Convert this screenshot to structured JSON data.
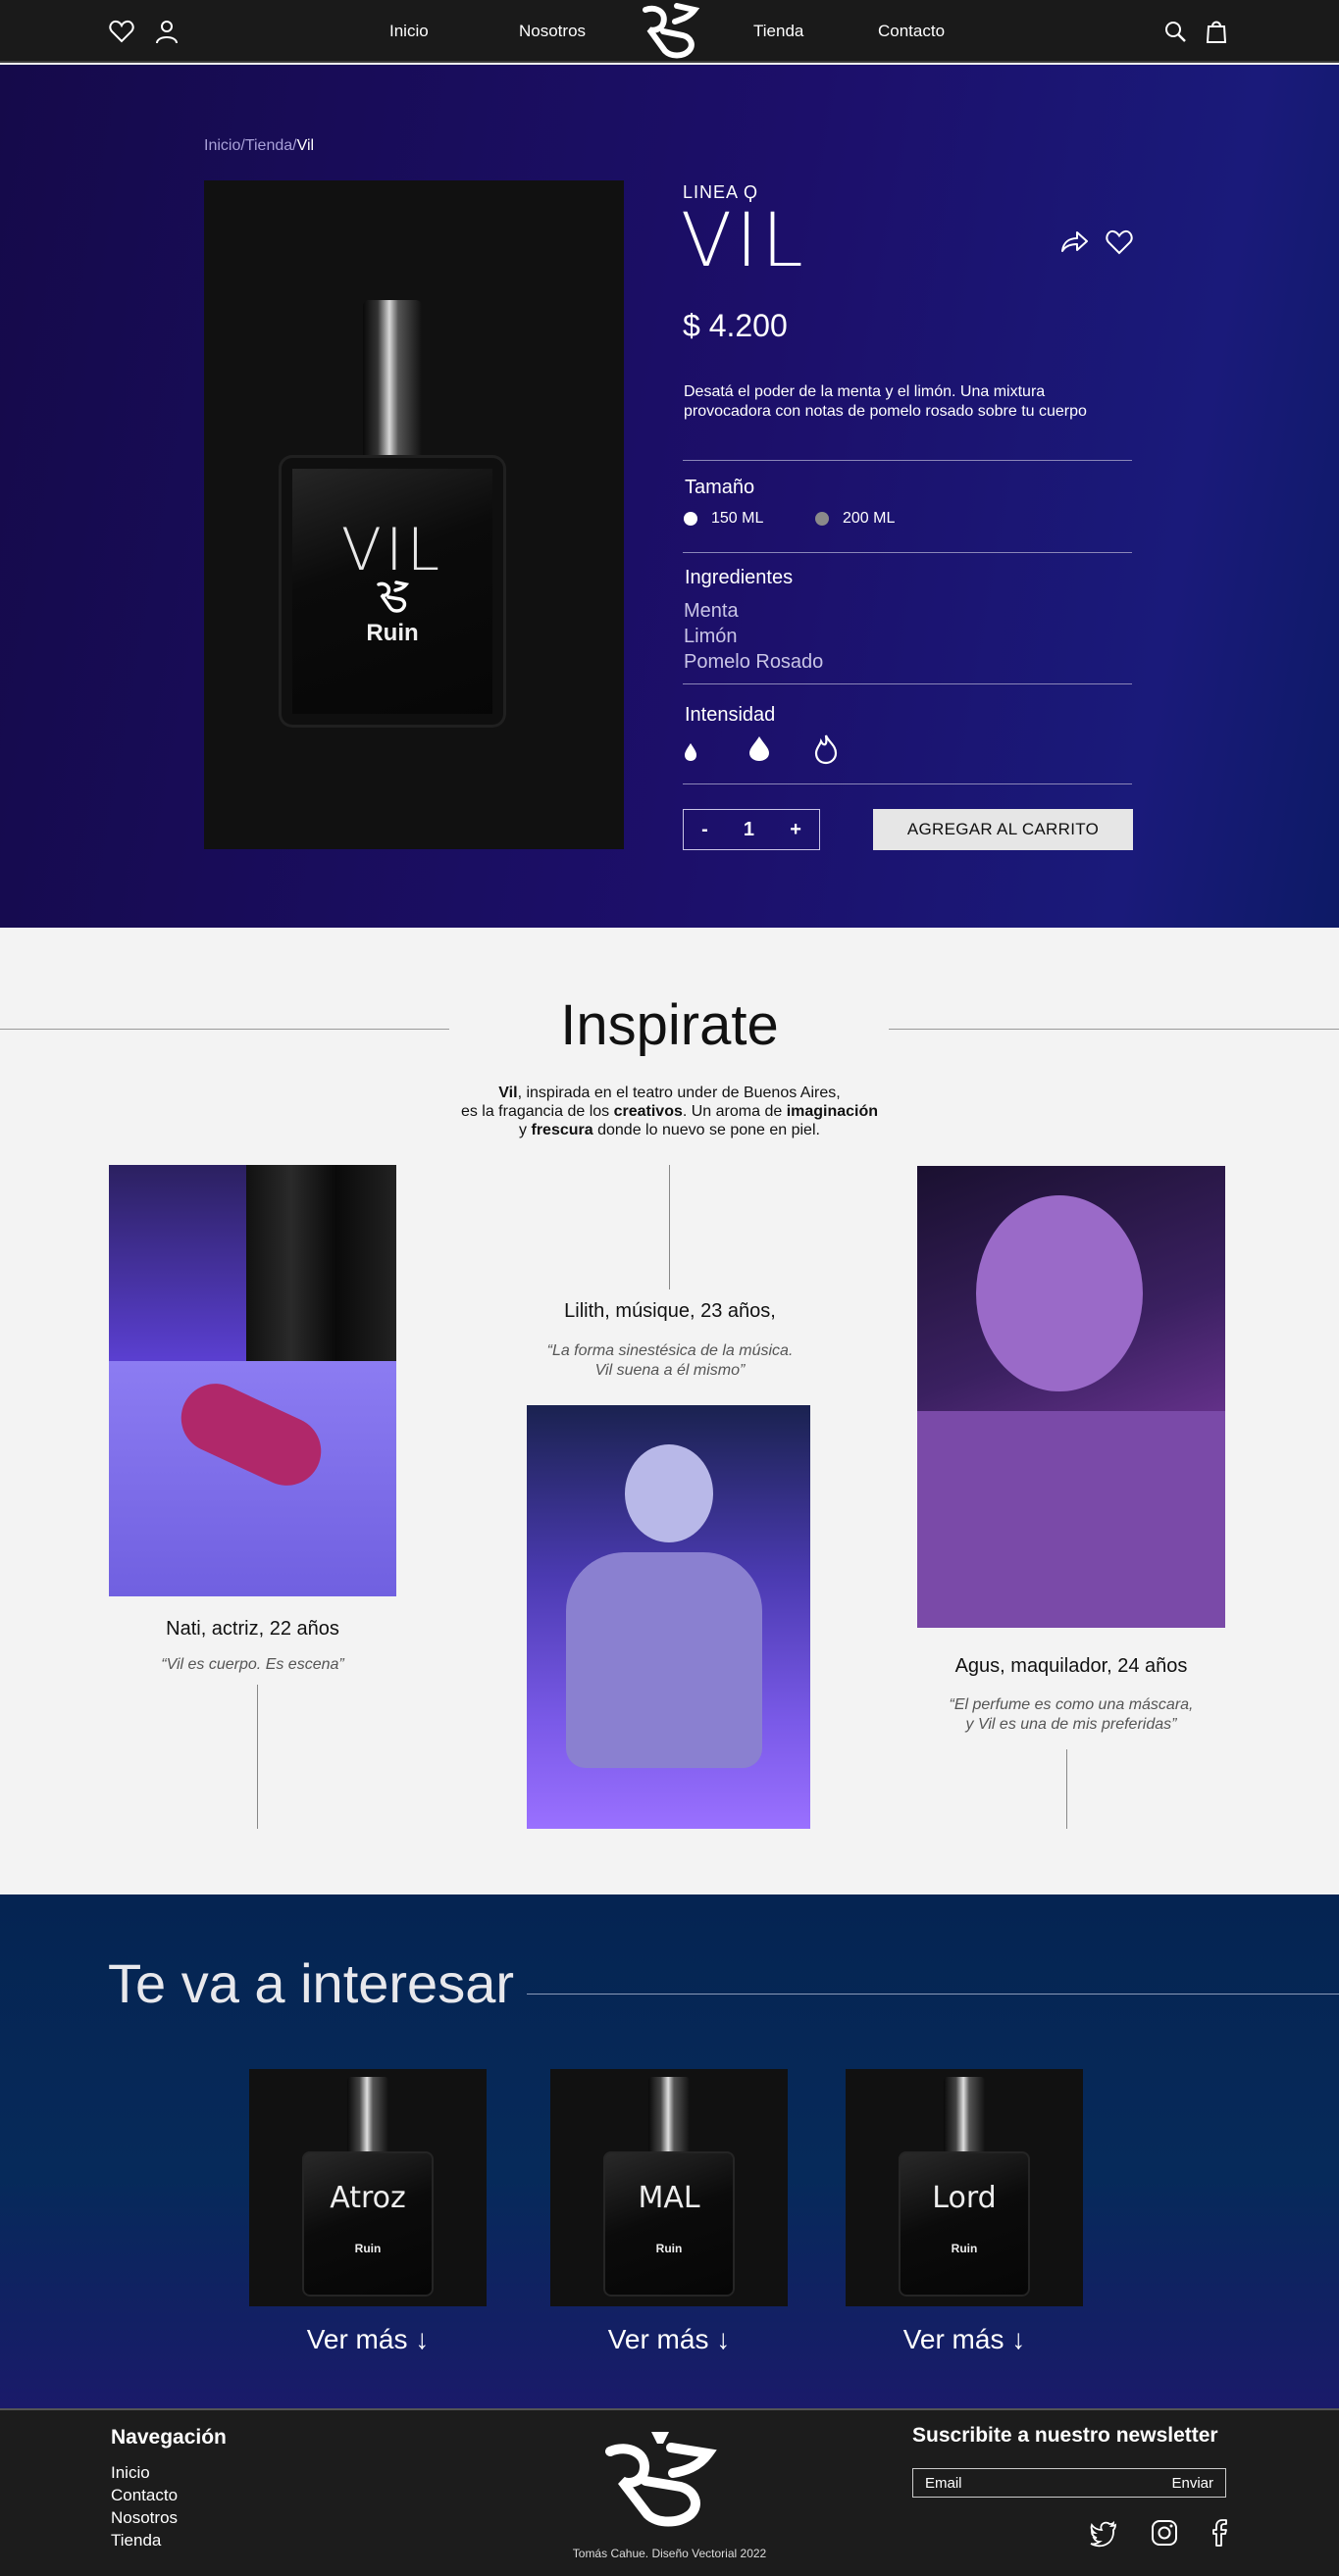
{
  "header": {
    "nav": [
      "Inicio",
      "Nosotros",
      "Tienda",
      "Contacto"
    ]
  },
  "breadcrumb": {
    "home": "Inicio",
    "sep1": "/",
    "shop": "Tienda",
    "sep2": "/",
    "current": "Vil"
  },
  "product": {
    "image_name": "VIL",
    "image_brand": "Ruin",
    "line": "LINEA Ϙ",
    "name": "VIL",
    "price": "$  4.200",
    "description": "Desatá el poder de la menta y el limón. Una mixtura provocadora con notas de pomelo rosado sobre tu cuerpo",
    "size_label": "Tamaño",
    "sizes": [
      {
        "label": "150 ML",
        "selected": true,
        "color": "#ffffff"
      },
      {
        "label": "200 ML",
        "selected": false,
        "color": "#8a8a8a"
      }
    ],
    "ingredients_label": "Ingredientes",
    "ingredients": [
      "Menta",
      "Limón",
      "Pomelo Rosado"
    ],
    "intensity_label": "Intensidad",
    "quantity": "1",
    "qty_minus": "-",
    "qty_plus": "+",
    "add_to_cart": "AGREGAR AL CARRITO"
  },
  "inspirate": {
    "title": "Inspirate",
    "intro": {
      "l1a": "Vil",
      "l1b": ", inspirada en el teatro under de Buenos Aires,",
      "l2a": "es la fragancia de los ",
      "l2b": "creativos",
      "l2c": ". Un aroma de ",
      "l2d": "imaginación",
      "l3a": "y ",
      "l3b": "frescura",
      "l3c": " donde lo nuevo se pone en piel."
    },
    "people": [
      {
        "caption": "Nati, actriz, 22 años",
        "quote": "“Vil es cuerpo. Es escena”"
      },
      {
        "caption": "Lilith,  músique, 23 años,",
        "quote1": "“La forma sinestésica de la música.",
        "quote2": "Vil suena a él mismo”"
      },
      {
        "caption": "Agus, maquilador, 24 años",
        "quote1": "“El perfume es como una máscara,",
        "quote2": "y Vil es una de mis preferidas”"
      }
    ]
  },
  "interest": {
    "title": "Te va a interesar",
    "products": [
      {
        "name": "Atroz",
        "brand": "Ruin",
        "cta": "Ver más ↓"
      },
      {
        "name": "MAL",
        "brand": "Ruin",
        "cta": "Ver más ↓"
      },
      {
        "name": "Lord",
        "brand": "Ruin",
        "cta": "Ver más ↓"
      }
    ]
  },
  "footer": {
    "nav_title": "Navegación",
    "nav": [
      "Inicio",
      "Contacto",
      "Nosotros",
      "Tienda"
    ],
    "credit": "Tomás Cahue. Diseño Vectorial 2022",
    "newsletter_title": "Suscribite a nuestro newsletter",
    "email_placeholder": "Email",
    "send": "Enviar"
  },
  "colors": {
    "hero_start": "#150a4a",
    "hero_end": "#0d1a66",
    "interest_bg": "#062a5a",
    "footer_bg": "#1c1c1c",
    "header_bg": "#1a1a1a"
  }
}
